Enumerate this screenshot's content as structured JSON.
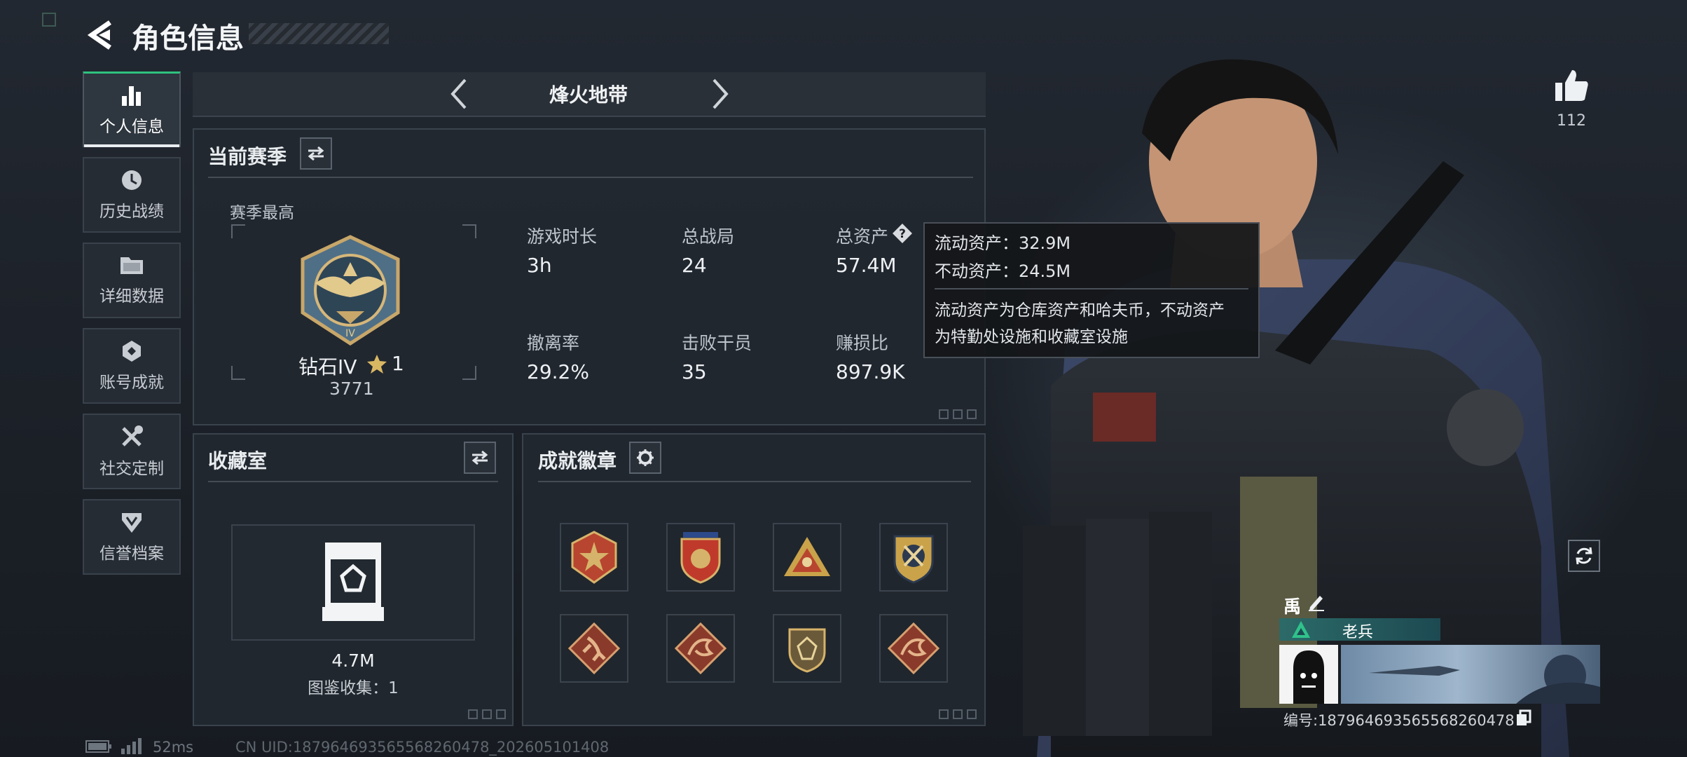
{
  "header": {
    "title": "角色信息"
  },
  "sidebar": {
    "items": [
      {
        "label": "个人信息",
        "icon": "bar-chart-icon",
        "active": true
      },
      {
        "label": "历史战绩",
        "icon": "clock-icon"
      },
      {
        "label": "详细数据",
        "icon": "folder-icon"
      },
      {
        "label": "账号成就",
        "icon": "achievement-icon"
      },
      {
        "label": "社交定制",
        "icon": "tools-icon"
      },
      {
        "label": "信誉档案",
        "icon": "shield-badge-icon"
      }
    ]
  },
  "mode_selector": {
    "label": "烽火地带"
  },
  "season": {
    "title": "当前赛季",
    "best_label": "赛季最高",
    "rank_name": "钻石IV",
    "rank_stars": "1",
    "rank_score": "3771",
    "stats": [
      {
        "label": "游戏时长",
        "value": "3h"
      },
      {
        "label": "总战局",
        "value": "24"
      },
      {
        "label": "总资产",
        "value": "57.4M"
      },
      {
        "label": "撤离率",
        "value": "29.2%"
      },
      {
        "label": "击败干员",
        "value": "35"
      },
      {
        "label": "赚损比",
        "value": "897.9K"
      }
    ]
  },
  "tooltip": {
    "liquid": "流动资产：32.9M",
    "fixed": "不动资产：24.5M",
    "desc_line1": "流动资产为仓库资产和哈夫币，不动资产",
    "desc_line2": "为特勤处设施和收藏室设施"
  },
  "collection": {
    "title": "收藏室",
    "value": "4.7M",
    "count": "图鉴收集：1"
  },
  "achievements": {
    "title": "成就徽章",
    "badges": [
      {
        "icon": "star-emblem-icon",
        "color": "#b8452f"
      },
      {
        "icon": "shield-emblem-icon",
        "color": "#c03a2b"
      },
      {
        "icon": "triangle-emblem-icon",
        "color": "#c9a24a"
      },
      {
        "icon": "anchor-emblem-icon",
        "color": "#c9a24a"
      },
      {
        "icon": "runner-badge-icon",
        "color": "#c86a4a"
      },
      {
        "icon": "dragon-badge-icon",
        "color": "#c86a4a"
      },
      {
        "icon": "gem-shield-badge-icon",
        "color": "#b89a50"
      },
      {
        "icon": "dragon-badge-icon",
        "color": "#c86a4a"
      }
    ]
  },
  "likes": {
    "count": "112"
  },
  "player": {
    "name": "禹",
    "title": "老兵",
    "id_text": "编号:18796469356556826047​8"
  },
  "footer": {
    "ping": "52ms",
    "uid": "CN UID:18796469356556826047​8_202605101408"
  }
}
